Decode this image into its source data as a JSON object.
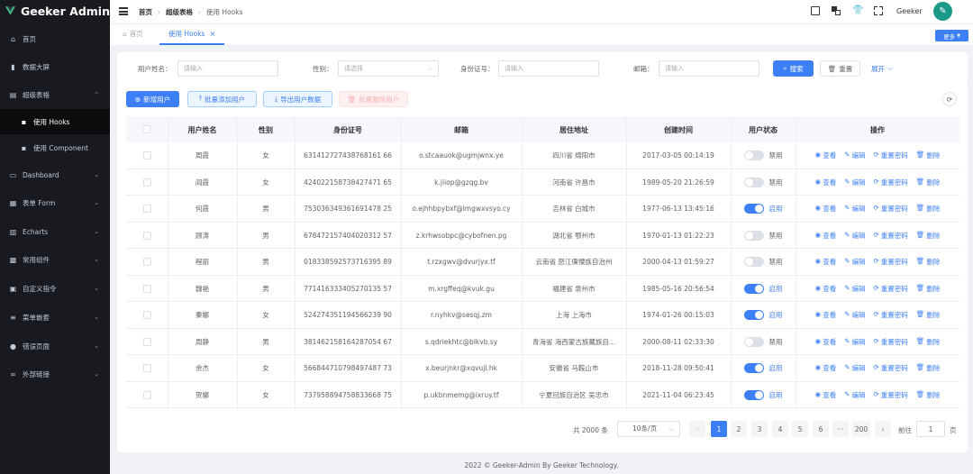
{
  "app": {
    "title": "Geeker Admin",
    "accent": "#3c7ff6",
    "sidebar_bg": "#191a20"
  },
  "sidebar": {
    "items": [
      {
        "label": "首页",
        "icon": "home-icon",
        "arrow": false,
        "sub": false,
        "active": false
      },
      {
        "label": "数据大屏",
        "icon": "chart-bar-icon",
        "arrow": false,
        "sub": false,
        "active": false
      },
      {
        "label": "超级表格",
        "icon": "table-icon",
        "arrow": true,
        "sub": false,
        "active": false
      },
      {
        "label": "使用 Hooks",
        "icon": "grid-icon",
        "arrow": false,
        "sub": true,
        "active": true
      },
      {
        "label": "使用 Component",
        "icon": "grid-icon",
        "arrow": false,
        "sub": true,
        "active": false
      },
      {
        "label": "Dashboard",
        "icon": "dashboard-icon",
        "arrow": true,
        "sub": false,
        "active": false
      },
      {
        "label": "表单 Form",
        "icon": "form-icon",
        "arrow": true,
        "sub": false,
        "active": false
      },
      {
        "label": "Echarts",
        "icon": "echarts-icon",
        "arrow": true,
        "sub": false,
        "active": false
      },
      {
        "label": "常用组件",
        "icon": "components-icon",
        "arrow": true,
        "sub": false,
        "active": false
      },
      {
        "label": "自定义指令",
        "icon": "directive-icon",
        "arrow": true,
        "sub": false,
        "active": false
      },
      {
        "label": "菜单嵌套",
        "icon": "menu-icon",
        "arrow": true,
        "sub": false,
        "active": false
      },
      {
        "label": "错误页面",
        "icon": "warning-icon",
        "arrow": true,
        "sub": false,
        "active": false
      },
      {
        "label": "外部链接",
        "icon": "link-icon",
        "arrow": true,
        "sub": false,
        "active": false
      }
    ]
  },
  "header": {
    "breadcrumb": [
      "首页",
      "超级表格",
      "使用 Hooks"
    ],
    "username": "Geeker"
  },
  "tabs": {
    "items": [
      {
        "label": "首页",
        "icon": "home-icon"
      },
      {
        "label": "使用 Hooks",
        "icon": ""
      }
    ],
    "more_label": "更多"
  },
  "search": {
    "fields": [
      {
        "label": "用户姓名：",
        "placeholder": "请输入",
        "kind": "input"
      },
      {
        "label": "性别：",
        "placeholder": "请选择",
        "kind": "select"
      },
      {
        "label": "身份证号：",
        "placeholder": "请输入",
        "kind": "input"
      },
      {
        "label": "邮箱：",
        "placeholder": "请输入",
        "kind": "input"
      }
    ],
    "search_label": "搜索",
    "reset_label": "重置",
    "expand_label": "展开"
  },
  "toolbar": {
    "add_label": "新增用户",
    "batch_add_label": "批量添加用户",
    "export_label": "导出用户数据",
    "batch_delete_label": "批量删除用户"
  },
  "table": {
    "columns": [
      "用户姓名",
      "性别",
      "身份证号",
      "邮箱",
      "居住地址",
      "创建时间",
      "用户状态",
      "操作"
    ],
    "status_labels": {
      "enabled": "启用",
      "disabled": "禁用"
    },
    "op_labels": [
      "查看",
      "编辑",
      "重置密码",
      "删除"
    ],
    "rows": [
      {
        "name": "周霞",
        "gender": "女",
        "id": "631412727438768161 66",
        "email": "o.stcaauok@ugmjwnx.ye",
        "address": "四川省 绵阳市",
        "created": "2017-03-05 00:14:19",
        "enabled": false
      },
      {
        "name": "阎霞",
        "gender": "女",
        "id": "424022158738427471 65",
        "email": "k.jiiop@gzqg.bv",
        "address": "河南省 许昌市",
        "created": "1989-05-20 21:26:59",
        "enabled": false
      },
      {
        "name": "何霞",
        "gender": "男",
        "id": "753036349361691478 25",
        "email": "o.ejhhbpybxf@lmgwxvsyo.cy",
        "address": "吉林省 白城市",
        "created": "1977-06-13 13:45:16",
        "enabled": true
      },
      {
        "name": "顾涛",
        "gender": "男",
        "id": "678472157404020312 57",
        "email": "z.krhwsobpc@cybofnen.pg",
        "address": "湖北省 鄂州市",
        "created": "1970-01-13 01:22:23",
        "enabled": false
      },
      {
        "name": "程丽",
        "gender": "男",
        "id": "018338592573716395 89",
        "email": "t.rzxgwv@dvurjyx.tf",
        "address": "云南省 怒江傈僳族自治州",
        "created": "2000-04-13 01:59:27",
        "enabled": false
      },
      {
        "name": "魏艳",
        "gender": "男",
        "id": "771416333405270135 57",
        "email": "m.xrgffeq@kvuk.gu",
        "address": "福建省 泉州市",
        "created": "1985-05-16 20:56:54",
        "enabled": true
      },
      {
        "name": "秦娜",
        "gender": "女",
        "id": "524274351194566239 90",
        "email": "r.nyhkv@sesqj.zm",
        "address": "上海 上海市",
        "created": "1974-01-26 00:15:03",
        "enabled": true
      },
      {
        "name": "周静",
        "gender": "男",
        "id": "381462158164287054 67",
        "email": "s.qdriekhtc@blkvb.sy",
        "address": "青海省 海西蒙古族藏族自...",
        "created": "2000-08-11 02:33:30",
        "enabled": false
      },
      {
        "name": "余杰",
        "gender": "女",
        "id": "566844710798497487 73",
        "email": "x.beurjnkr@xqvujl.hk",
        "address": "安徽省 马鞍山市",
        "created": "2018-11-28 09:50:41",
        "enabled": true
      },
      {
        "name": "贺娜",
        "gender": "女",
        "id": "737958894758833668 75",
        "email": "p.ukbnmemg@ixruy.tf",
        "address": "宁夏回族自治区 吴忠市",
        "created": "2021-11-04 06:23:45",
        "enabled": true
      }
    ]
  },
  "pagination": {
    "total_label": "共 2000 条",
    "page_size_label": "10条/页",
    "pages": [
      "1",
      "2",
      "3",
      "4",
      "5",
      "6",
      "···",
      "200"
    ],
    "current": "1",
    "goto_label": "前往",
    "goto_value": "1",
    "page_unit": "页"
  },
  "footer": {
    "text": "2022 © Geeker-Admin By Geeker Technology."
  }
}
